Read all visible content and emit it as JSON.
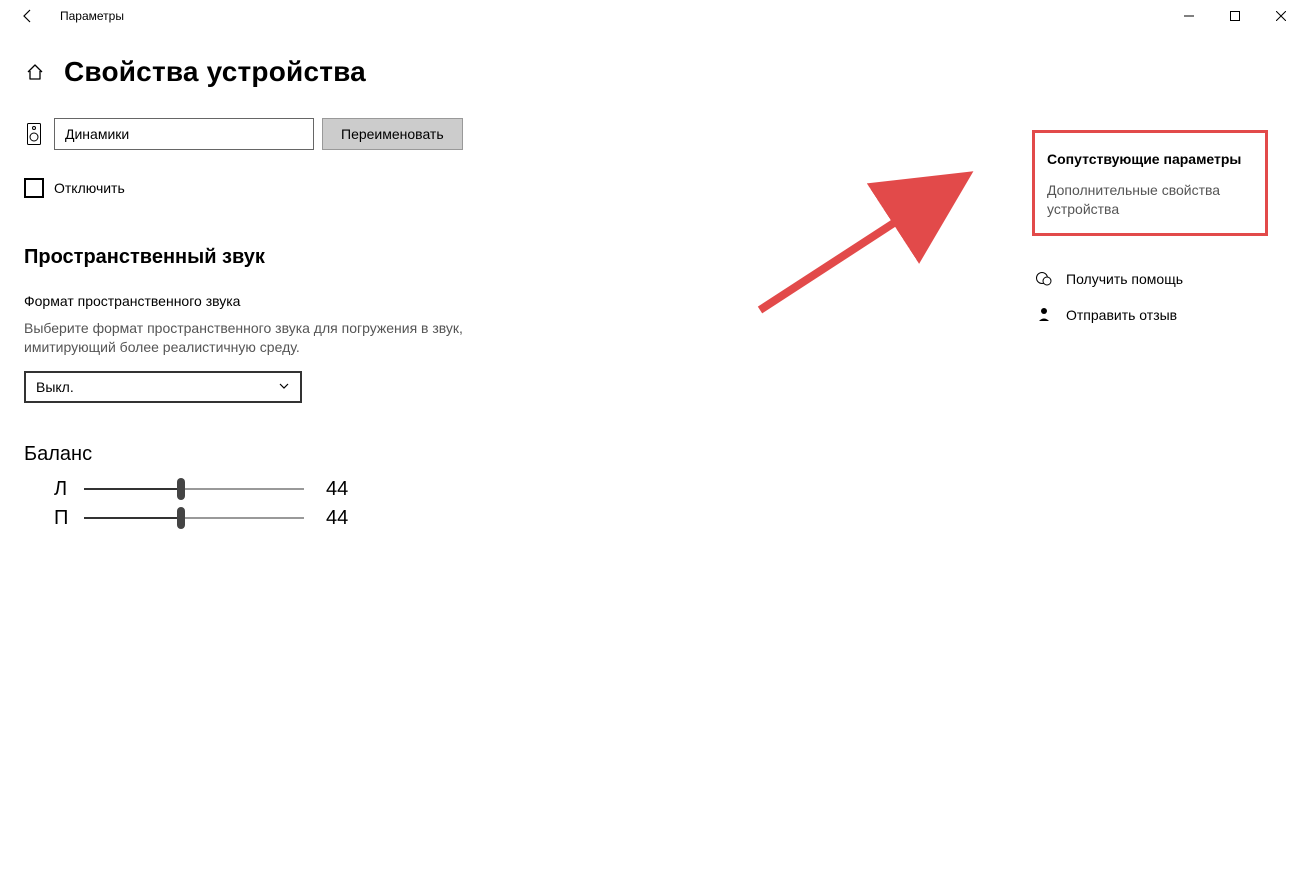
{
  "window": {
    "app_title": "Параметры"
  },
  "page": {
    "title": "Свойства устройства"
  },
  "device": {
    "name_value": "Динамики",
    "rename_label": "Переименовать",
    "disable_label": "Отключить"
  },
  "spatial": {
    "section_title": "Пространственный звук",
    "format_label": "Формат пространственного звука",
    "description": "Выберите формат пространственного звука для погружения в звук, имитирующий более реалистичную среду.",
    "dropdown_value": "Выкл."
  },
  "balance": {
    "title": "Баланс",
    "left_label": "Л",
    "left_value": "44",
    "right_label": "П",
    "right_value": "44",
    "left_pct": 44,
    "right_pct": 44
  },
  "related": {
    "title": "Сопутствующие параметры",
    "link": "Дополнительные свойства устройства"
  },
  "help": {
    "get_help": "Получить помощь",
    "feedback": "Отправить отзыв"
  }
}
